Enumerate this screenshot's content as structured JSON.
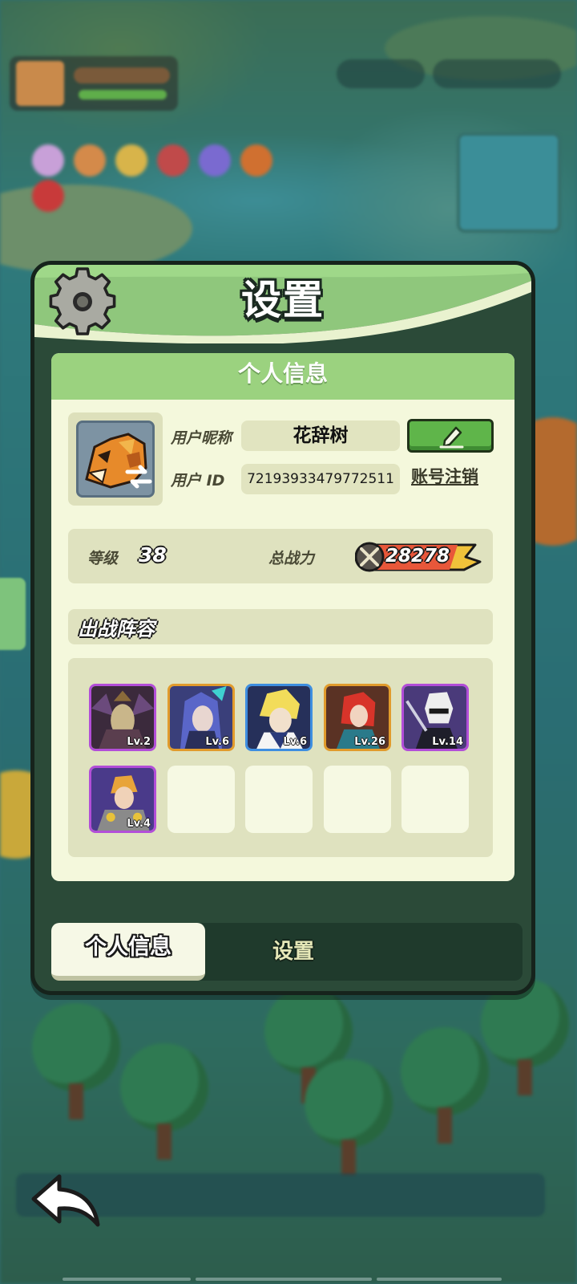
{
  "panel": {
    "title": "设置",
    "card_header": "个人信息"
  },
  "profile": {
    "nickname_label": "用户昵称",
    "nickname": "花辞树",
    "id_label": "用户  ID",
    "user_id": "7219393347977251​1",
    "cancel_account": "账号注销"
  },
  "stats": {
    "level_label": "等级",
    "level": "38",
    "power_label": "总战力",
    "power": "28278"
  },
  "lineup": {
    "title": "出战阵容",
    "heroes": [
      {
        "level": "Lv.2",
        "frame": "purple"
      },
      {
        "level": "Lv.6",
        "frame": "orange"
      },
      {
        "level": "Lv.6",
        "frame": "blue"
      },
      {
        "level": "Lv.26",
        "frame": "orange"
      },
      {
        "level": "Lv.14",
        "frame": "purple"
      },
      {
        "level": "Lv.4",
        "frame": "purple"
      }
    ],
    "empty_slots": 4
  },
  "tabs": {
    "active": "个人信息",
    "inactive": "设置"
  },
  "colors": {
    "header_green": "#9bd27f",
    "panel_bg": "#2b4a38",
    "card_bg": "#f4f8dc",
    "edit_button": "#5fb54a",
    "power_fill": "#f0c23a"
  },
  "icons": {
    "settings": "gear-icon",
    "edit": "pencil-icon",
    "swap_avatar": "swap-icon",
    "power": "crossed-swords-icon",
    "back": "back-arrow-icon"
  }
}
